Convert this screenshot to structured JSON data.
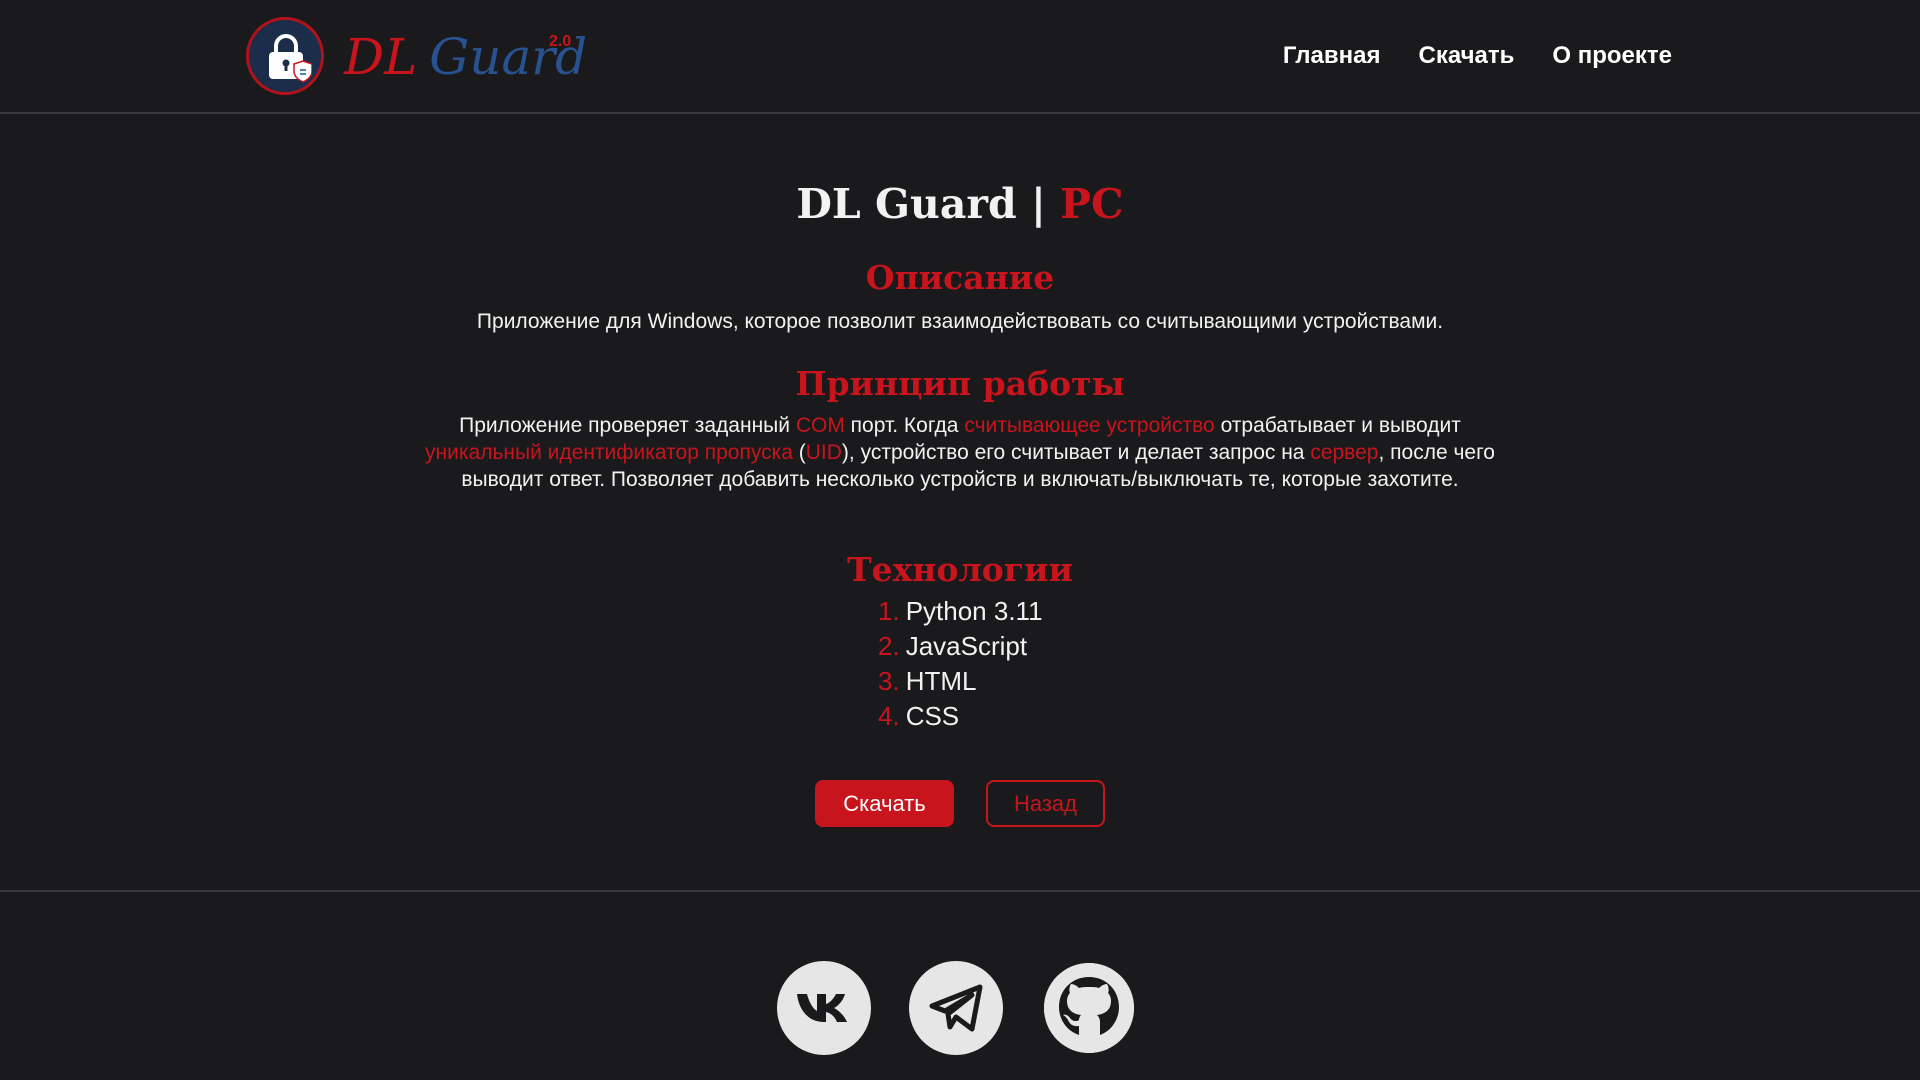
{
  "header": {
    "brand_dl": "DL",
    "brand_guard": "Guard",
    "brand_version": "2.0",
    "nav": [
      {
        "label": "Главная"
      },
      {
        "label": "Скачать"
      },
      {
        "label": "О проекте"
      }
    ]
  },
  "main": {
    "title_main": "DL Guard | ",
    "title_accent": "PC",
    "description": {
      "heading": "Описание",
      "text": "Приложение для Windows, которое позволит взаимодействовать со считывающими устройствами."
    },
    "principle": {
      "heading": "Принцип работы",
      "parts": [
        "Приложение проверяет заданный ",
        "COM",
        " порт. Когда ",
        "считывающее устройство",
        " отрабатывает и выводит ",
        "уникальный идентификатор пропуска",
        " (",
        "UID",
        "), устройство его считывает и делает запрос на ",
        "сервер",
        ", после чего выводит ответ. Позволяет добавить несколько устройств и включать/выключать те, которые захотите."
      ]
    },
    "technologies": {
      "heading": "Технологии",
      "items": [
        {
          "num": "1.",
          "name": "Python 3.11"
        },
        {
          "num": "2.",
          "name": "JavaScript"
        },
        {
          "num": "3.",
          "name": "HTML"
        },
        {
          "num": "4.",
          "name": "CSS"
        }
      ]
    },
    "buttons": {
      "download": "Скачать",
      "back": "Назад"
    }
  },
  "footer": {
    "social_icons": [
      "vk-icon",
      "telegram-icon",
      "github-icon"
    ]
  },
  "colors": {
    "background": "#1a1a1c",
    "accent": "#c8141c",
    "brand_blue": "#28518f",
    "text": "#f2f2f2"
  }
}
